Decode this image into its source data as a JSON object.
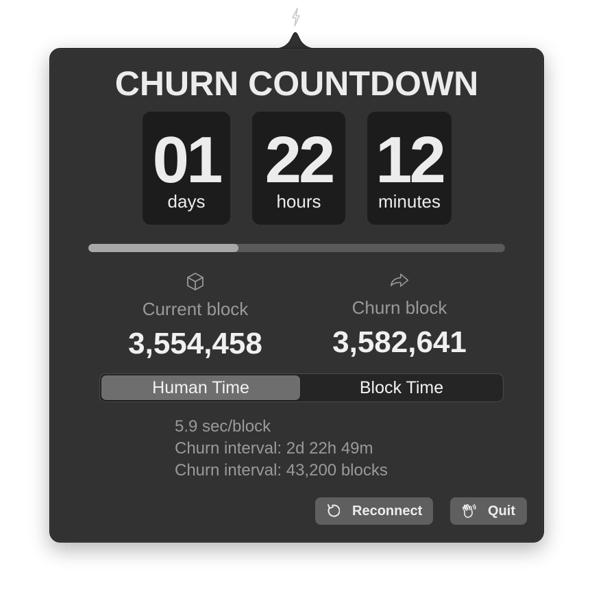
{
  "menubar": {
    "icon": "bolt-icon"
  },
  "header": {
    "title": "CHURN COUNTDOWN"
  },
  "countdown": [
    {
      "value": "01",
      "unit": "days"
    },
    {
      "value": "22",
      "unit": "hours"
    },
    {
      "value": "12",
      "unit": "minutes"
    }
  ],
  "progress": {
    "fraction": 0.36
  },
  "blocks": {
    "current": {
      "icon": "cube-icon",
      "label": "Current block",
      "value": "3,554,458"
    },
    "churn": {
      "icon": "arrow-share-icon",
      "label": "Churn block",
      "value": "3,582,641"
    }
  },
  "mode_toggle": {
    "options": [
      "Human Time",
      "Block Time"
    ],
    "selected": "Human Time"
  },
  "info": {
    "lines": [
      "5.9 sec/block",
      "Churn interval: 2d 22h 49m",
      "Churn interval: 43,200 blocks"
    ]
  },
  "buttons": {
    "reconnect": {
      "icon": "reconnect-icon",
      "label": "Reconnect"
    },
    "quit": {
      "icon": "waving-hand-icon",
      "label": "Quit"
    }
  },
  "colors": {
    "panel": "#323232",
    "card": "#1c1c1c",
    "text": "#ececec",
    "muted": "#9a9a9a",
    "button": "#5f5f5f"
  }
}
